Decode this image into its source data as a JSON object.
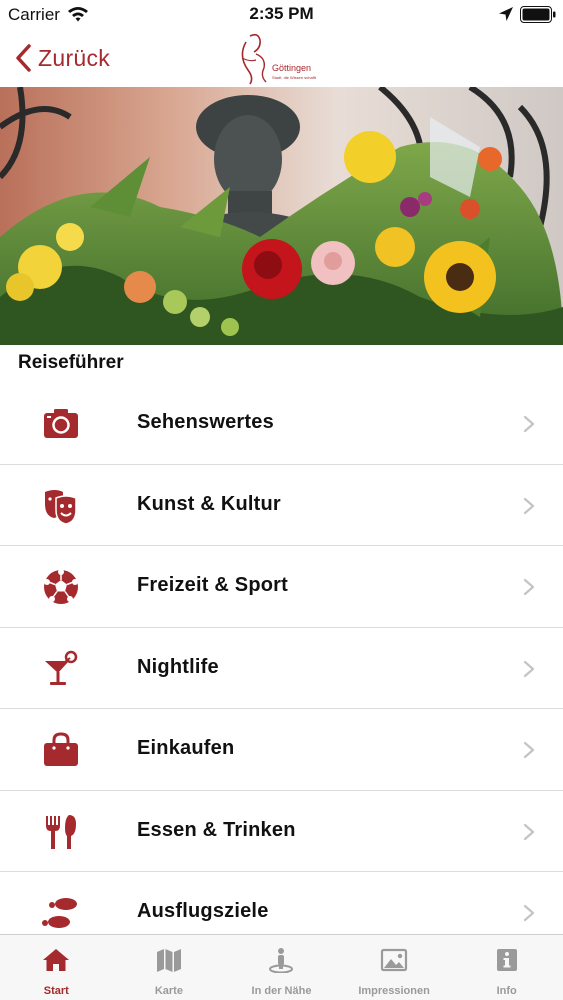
{
  "status_bar": {
    "carrier": "Carrier",
    "time": "2:35 PM"
  },
  "nav": {
    "back_label": "Zurück",
    "logo_name": "Göttingen",
    "logo_subtitle": "Stadt, die Wissen schafft"
  },
  "guide": {
    "title": "Reiseführer",
    "items": [
      {
        "label": "Sehenswertes",
        "icon": "camera-icon"
      },
      {
        "label": "Kunst & Kultur",
        "icon": "theater-masks-icon"
      },
      {
        "label": "Freizeit & Sport",
        "icon": "soccer-ball-icon"
      },
      {
        "label": "Nightlife",
        "icon": "cocktail-icon"
      },
      {
        "label": "Einkaufen",
        "icon": "shopping-bag-icon"
      },
      {
        "label": "Essen & Trinken",
        "icon": "fork-knife-icon"
      },
      {
        "label": "Ausflugsziele",
        "icon": "footprints-icon"
      }
    ]
  },
  "tabs": [
    {
      "label": "Start",
      "icon": "home-icon",
      "active": true
    },
    {
      "label": "Karte",
      "icon": "map-icon",
      "active": false
    },
    {
      "label": "In der Nähe",
      "icon": "person-location-icon",
      "active": false
    },
    {
      "label": "Impressionen",
      "icon": "image-icon",
      "active": false
    },
    {
      "label": "Info",
      "icon": "info-icon",
      "active": false
    }
  ],
  "colors": {
    "accent": "#a52a2e",
    "inactive_tab": "#9a9a9a",
    "tab_bar_bg": "#f7f7f7",
    "separator": "#dcdcdc"
  }
}
